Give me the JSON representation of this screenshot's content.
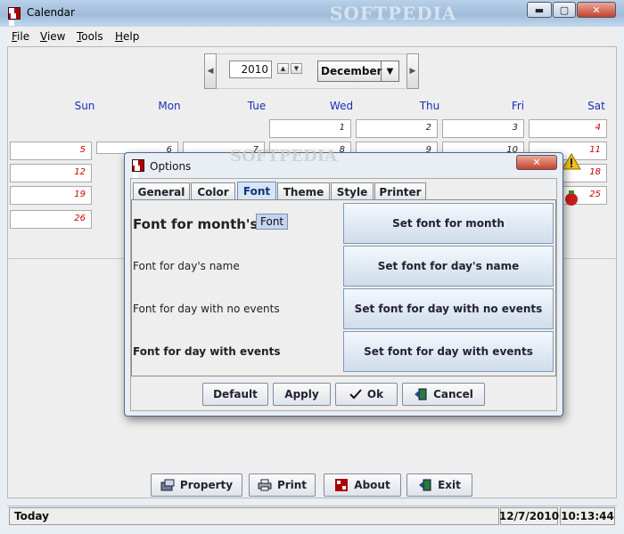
{
  "window": {
    "title": "Calendar",
    "watermark": "SOFTPEDIA",
    "minimize_label": "▬",
    "maximize_label": "▢",
    "close_label": "✕"
  },
  "menubar": {
    "items": [
      {
        "label": "File",
        "mnemonic": "F",
        "rest": "ile"
      },
      {
        "label": "View",
        "mnemonic": "V",
        "rest": "iew"
      },
      {
        "label": "Tools",
        "mnemonic": "T",
        "rest": "ools"
      },
      {
        "label": "Help",
        "mnemonic": "H",
        "rest": "elp"
      }
    ]
  },
  "navigator": {
    "prev_label": "◀",
    "next_label": "▶",
    "year": "2010",
    "spin_up": "▲",
    "spin_down": "▼",
    "month": "December",
    "month_dropdown_arrow": "▼"
  },
  "calendar": {
    "day_names": [
      "Sun",
      "Mon",
      "Tue",
      "Wed",
      "Thu",
      "Fri",
      "Sat"
    ],
    "rows": [
      [
        "",
        "",
        "",
        "1",
        "2",
        "3",
        "4"
      ],
      [
        "5",
        "6",
        "7",
        "8",
        "9",
        "10",
        "11"
      ],
      [
        "12",
        "",
        "",
        "",
        "",
        "",
        "18"
      ],
      [
        "19",
        "",
        "",
        "",
        "",
        "",
        "25"
      ],
      [
        "26",
        "",
        "",
        "",
        "",
        "",
        ""
      ]
    ]
  },
  "bottom_buttons": {
    "property": "Property",
    "print": "Print",
    "about": "About",
    "exit": "Exit"
  },
  "statusbar": {
    "message": "Today",
    "date": "12/7/2010",
    "time": "10:13:44"
  },
  "dialog": {
    "title": "Options",
    "watermark": "SOFTPEDIA",
    "close_label": "✕",
    "tabs": [
      "General",
      "Color",
      "Font",
      "Theme",
      "Style",
      "Printer"
    ],
    "active_tab": "Font",
    "rows": [
      {
        "label": "Font for month's n",
        "button": "Set font for month"
      },
      {
        "label": "Font for day's name",
        "button": "Set font for day's name"
      },
      {
        "label": "Font for day with no events",
        "button": "Set font for day with no events"
      },
      {
        "label": "Font for day with events",
        "button": "Set font for day with events"
      }
    ],
    "tooltip": "Font",
    "buttons": {
      "default": "Default",
      "apply": "Apply",
      "ok": "Ok",
      "cancel": "Cancel"
    }
  },
  "colors": {
    "weekday_header": "#1a2fb8",
    "weekend_day": "#cc0000",
    "title_gradient_top": "#b9d1ea",
    "active_tab": "#d6e4f3"
  }
}
